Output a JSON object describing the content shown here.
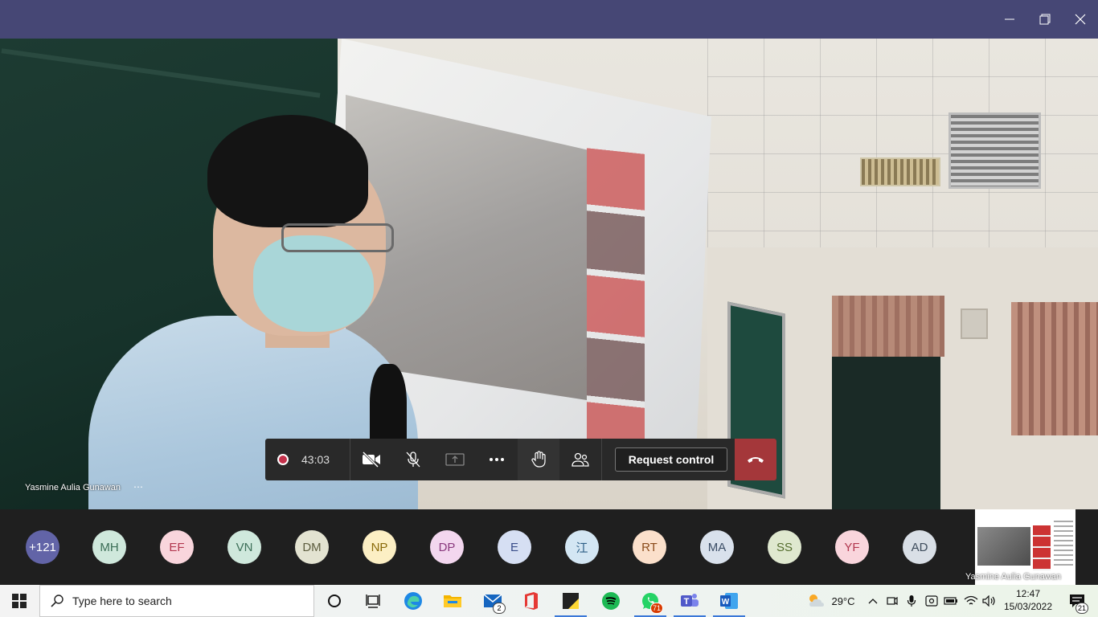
{
  "window": {
    "title_bar_color": "#464775",
    "minimize_icon": "minimize-icon",
    "maximize_icon": "restore-icon",
    "close_icon": "close-icon"
  },
  "stage": {
    "presenter_name": "Yasmine Aulia Gunawan",
    "more_label": "⋯"
  },
  "controls": {
    "recording_time": "43:03",
    "request_control_label": "Request control",
    "colors": {
      "bar": "#292929",
      "hangup": "#a4373a",
      "record": "#c4314b"
    }
  },
  "participants": {
    "overflow_label": "+121",
    "list": [
      {
        "initials": "MH",
        "bg": "#cfe8dc",
        "fg": "#3c6e57"
      },
      {
        "initials": "EF",
        "bg": "#f9d5dc",
        "fg": "#b2374f"
      },
      {
        "initials": "VN",
        "bg": "#cfe8dc",
        "fg": "#3c6e57"
      },
      {
        "initials": "DM",
        "bg": "#e3e3d1",
        "fg": "#5e5e40"
      },
      {
        "initials": "NP",
        "bg": "#fcefc4",
        "fg": "#8a6a0a"
      },
      {
        "initials": "DP",
        "bg": "#f3d7ef",
        "fg": "#8a3a7e"
      },
      {
        "initials": "E",
        "bg": "#d6dff3",
        "fg": "#3a4e8a"
      },
      {
        "initials": "江",
        "bg": "#d3e6f3",
        "fg": "#2d5f86"
      },
      {
        "initials": "RT",
        "bg": "#fbe0cb",
        "fg": "#8a4b1a"
      },
      {
        "initials": "MA",
        "bg": "#d9e1ec",
        "fg": "#3b4d66"
      },
      {
        "initials": "SS",
        "bg": "#dfe8cf",
        "fg": "#536b2c"
      },
      {
        "initials": "YF",
        "bg": "#f9d5dc",
        "fg": "#b2374f"
      },
      {
        "initials": "AD",
        "bg": "#d9dfe6",
        "fg": "#3e4c5c"
      }
    ],
    "self_preview_name": "Yasmine Aulia Gunawan"
  },
  "taskbar": {
    "search_placeholder": "Type here to search",
    "mail_badge": "2",
    "whatsapp_badge": "71",
    "weather_temp": "29°C",
    "time": "12:47",
    "date": "15/03/2022",
    "notifications_badge": "21"
  }
}
